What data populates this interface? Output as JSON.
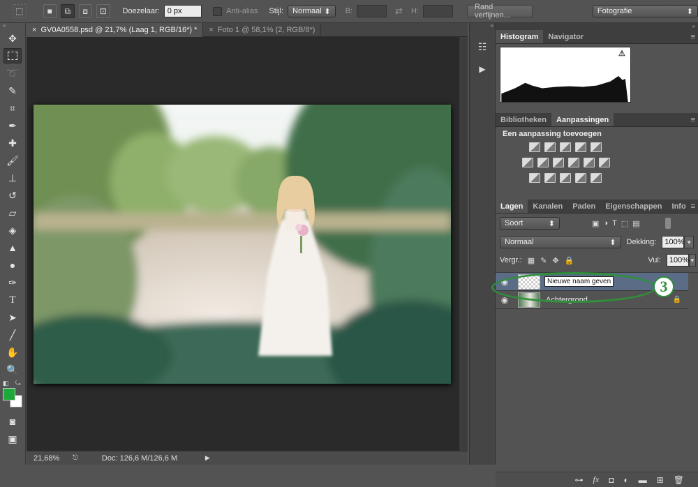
{
  "options_bar": {
    "feather_label": "Doezelaar:",
    "feather_value": "0 px",
    "antialias_label": "Anti-alias",
    "style_label": "Stijl:",
    "style_value": "Normaal",
    "width_label": "B:",
    "height_label": "H:",
    "refine_button": "Rand verfijnen...",
    "workspace_value": "Fotografie"
  },
  "tabs": [
    {
      "label": "GV0A0558.psd @ 21,7% (Laag 1, RGB/16*) *",
      "active": true
    },
    {
      "label": "Foto 1 @ 58,1% (2, RGB/8*)",
      "active": false
    }
  ],
  "status": {
    "zoom": "21,68%",
    "doc": "Doc: 126,6 M/126,6 M"
  },
  "histogram_panel": {
    "tabs": [
      "Histogram",
      "Navigator"
    ],
    "warning_icon": "warning-triangle-icon"
  },
  "adjustments_panel": {
    "tabs": [
      "Bibliotheken",
      "Aanpassingen"
    ],
    "title": "Een aanpassing toevoegen"
  },
  "layers_panel": {
    "tabs": [
      "Lagen",
      "Kanalen",
      "Paden",
      "Eigenschappen",
      "Info"
    ],
    "filter_value": "Soort",
    "blend_mode": "Normaal",
    "opacity_label": "Dekking:",
    "opacity_value": "100%",
    "lock_label": "Vergr.:",
    "fill_label": "Vul:",
    "fill_value": "100%",
    "layers": [
      {
        "name_edit": "Nieuwe naam geven",
        "selected": true
      },
      {
        "name": "Achtergrond",
        "selected": false
      }
    ],
    "annotation_number": "3"
  },
  "colors": {
    "foreground": "#1fa83a",
    "background": "#ffffff",
    "highlight": "#2f8f3a"
  }
}
